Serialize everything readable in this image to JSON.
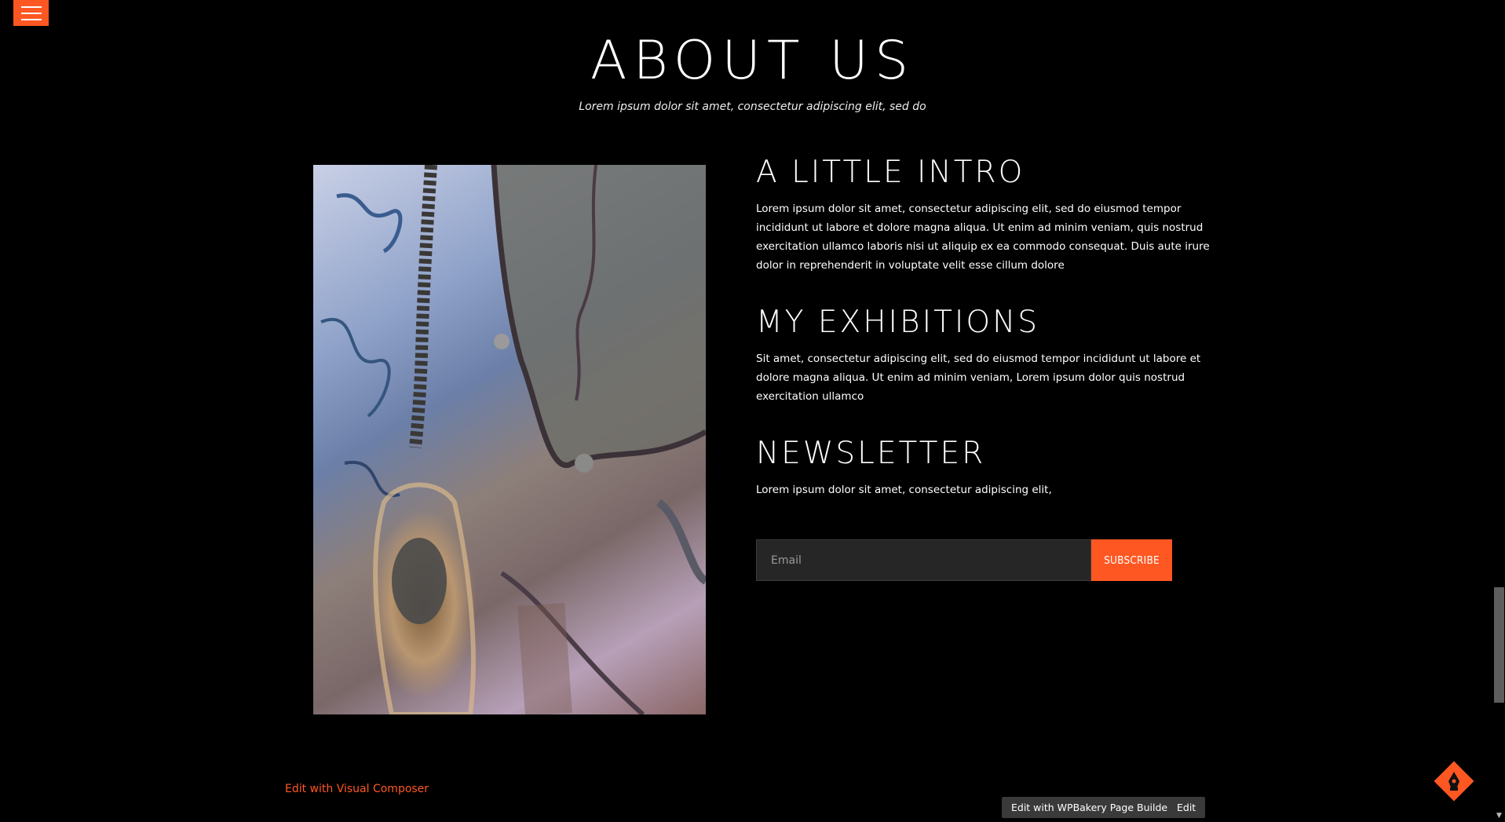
{
  "menu": {
    "icon": "hamburger-menu-icon"
  },
  "header": {
    "title": "ABOUT US",
    "subtitle": "Lorem ipsum dolor sit amet, consectetur adipiscing elit, sed do"
  },
  "sections": {
    "intro": {
      "heading": "A LITTLE INTRO",
      "text": "Lorem ipsum dolor sit amet, consectetur adipiscing elit, sed do eiusmod tempor incididunt ut labore et dolore magna aliqua. Ut enim ad minim veniam, quis nostrud exercitation ullamco laboris nisi ut aliquip ex ea commodo consequat. Duis aute irure dolor in reprehenderit in voluptate velit esse cillum dolore"
    },
    "exhibitions": {
      "heading": "MY EXHIBITIONS",
      "text": "Sit amet, consectetur adipiscing elit, sed do eiusmod tempor incididunt ut labore et dolore magna aliqua. Ut enim ad minim veniam, Lorem ipsum dolor quis nostrud exercitation ullamco"
    },
    "newsletter": {
      "heading": "NEWSLETTER",
      "text": "Lorem ipsum dolor sit amet, consectetur adipiscing elit,",
      "email_placeholder": "Email",
      "email_value": "",
      "subscribe_label": "SUBSCRIBE"
    }
  },
  "footer": {
    "visual_composer_link": "Edit with Visual Composer",
    "wpbakery_button": "Edit with WPBakery Page Builder",
    "edit_button": "Edit"
  },
  "colors": {
    "accent": "#ff5722",
    "background": "#000000",
    "input_bg": "#262626"
  },
  "floating": {
    "icon": "pen-nib-icon"
  }
}
